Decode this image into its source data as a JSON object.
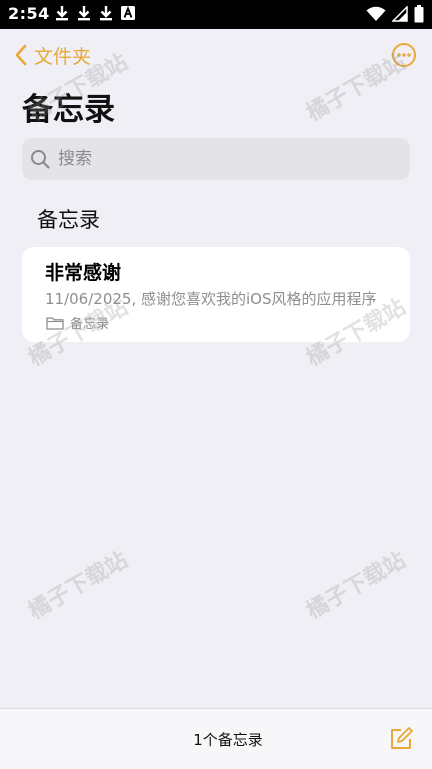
{
  "status_bar": {
    "time": "2:54",
    "notification_icons": [
      "download-icon",
      "download-icon",
      "download-icon",
      "accessibility-a-icon"
    ],
    "system_icons": [
      "wifi-icon",
      "signal-icon",
      "battery-icon"
    ]
  },
  "nav": {
    "back_label": "文件夹",
    "back_icon": "chevron-left-icon",
    "more_icon": "more-ellipsis-circle-icon",
    "accent_color": "#e8a83a"
  },
  "page": {
    "title": "备忘录"
  },
  "search": {
    "placeholder": "搜索",
    "value": ""
  },
  "section": {
    "header": "备忘录"
  },
  "notes": [
    {
      "title": "非常感谢",
      "preview": "11/06/2025, 感谢您喜欢我的iOS风格的应用程序",
      "folder": "备忘录",
      "folder_icon": "folder-icon"
    }
  ],
  "watermark": {
    "text": "橘子下载站"
  },
  "bottom_bar": {
    "count_text": "1个备忘录",
    "compose_icon": "compose-icon"
  }
}
